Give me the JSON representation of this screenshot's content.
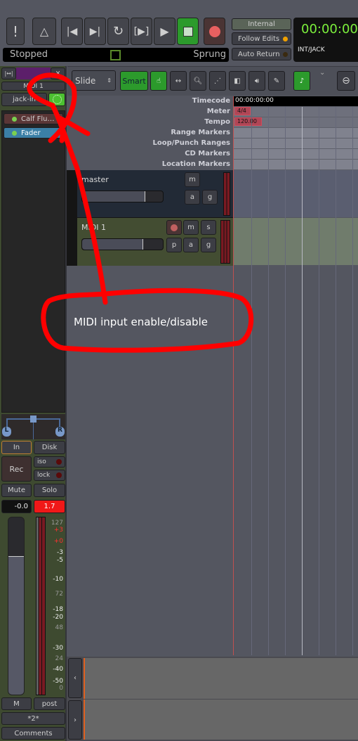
{
  "transport": {
    "status": "Stopped",
    "sprung": "Sprung",
    "internal": "Internal",
    "follow_edits": "Follow Edits",
    "auto_return": "Auto Return",
    "clock": "00:00:00",
    "clock_source": "INT/JACK",
    "buttons": [
      "alert",
      "metronome",
      "goto-start",
      "goto-end",
      "loop",
      "play-range",
      "play",
      "stop",
      "record"
    ]
  },
  "toolbar": {
    "edit_mode": "Slide",
    "smart": "Smart",
    "tools": [
      "grab",
      "range",
      "zoom",
      "draw-line",
      "stretch",
      "audition",
      "pencil"
    ]
  },
  "rulers": {
    "labels": [
      "Timecode",
      "Meter",
      "Tempo",
      "Range Markers",
      "Loop/Punch Ranges",
      "CD Markers",
      "Location Markers"
    ],
    "timecode": "00:00:00:00",
    "meter": "4/4",
    "tempo": "120.00"
  },
  "tracks": [
    {
      "name": "master",
      "buttons": [
        "m",
        "a",
        "g"
      ]
    },
    {
      "name": "MIDI 1",
      "buttons": [
        "m",
        "s",
        "p",
        "a",
        "g"
      ]
    }
  ],
  "strip": {
    "name": "MIDI 1",
    "input": "jack-in",
    "plugins": [
      "Calf Flu…",
      "Fader"
    ],
    "pan_l": "L",
    "pan_r": "R",
    "in": "In",
    "disk": "Disk",
    "rec": "Rec",
    "iso": "iso",
    "lock": "lock",
    "mute": "Mute",
    "solo": "Solo",
    "gain": "-0.0",
    "peak": "1.7",
    "scale": [
      "127",
      "+3",
      "+0",
      "-3",
      "-5",
      "-10",
      "72",
      "-18",
      "-20",
      "48",
      "-30",
      "24",
      "-40",
      "-50",
      "0"
    ],
    "meter_mode": "M",
    "meter_point": "post",
    "group": "*2*",
    "comments": "Comments"
  },
  "annotation": {
    "text": "MIDI input enable/disable",
    "color": "#ff0000"
  },
  "colors": {
    "accent_green": "#2c9a2c",
    "record": "#e86060",
    "clock": "#7cf03c",
    "midi_track": "#434d32",
    "master_track": "#222a36"
  }
}
